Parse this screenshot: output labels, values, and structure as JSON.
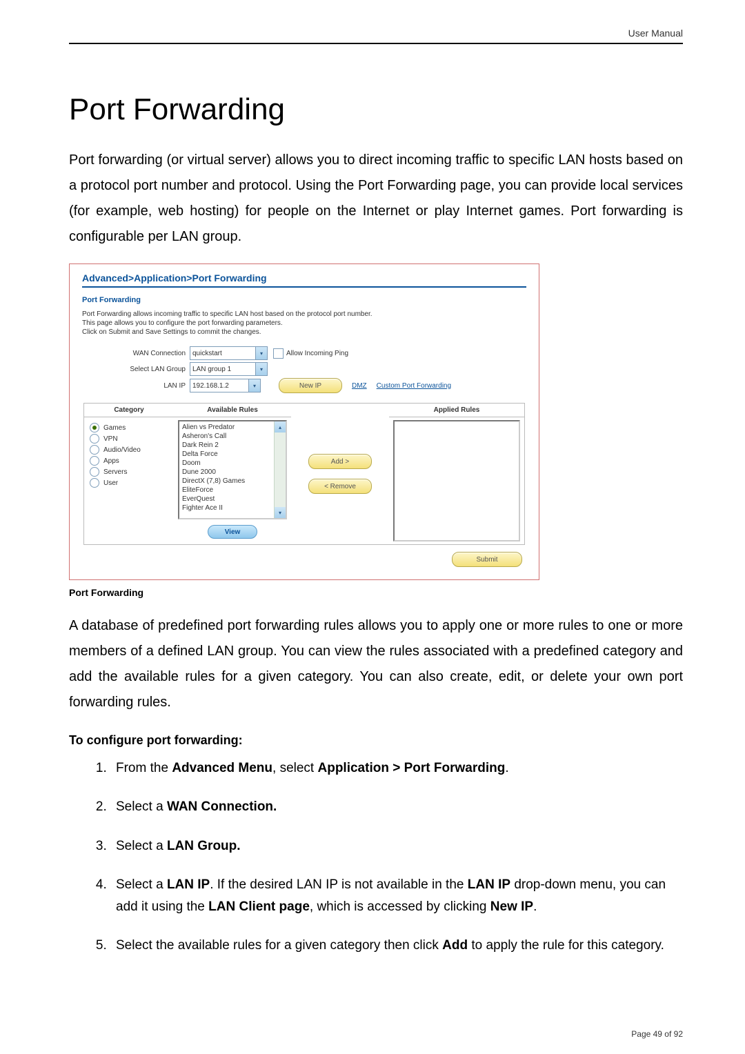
{
  "header": {
    "doc_label": "User Manual"
  },
  "title": "Port Forwarding",
  "intro": "Port forwarding (or virtual server) allows you to direct incoming traffic to specific LAN hosts based on a protocol port number and protocol. Using the Port Forwarding page, you can provide local services (for example, web hosting) for people on the Internet or play Internet games. Port forwarding is configurable per LAN group.",
  "figure": {
    "breadcrumb": "Advanced>Application>Port Forwarding",
    "panel_title": "Port Forwarding",
    "desc1": "Port Forwarding allows incoming traffic to specific LAN host based on the protocol port number.",
    "desc2": "This page allows you to configure the port forwarding parameters.",
    "desc3": "Click on Submit and Save Settings to commit the changes.",
    "labels": {
      "wan": "WAN Connection",
      "lan_group": "Select LAN Group",
      "lan_ip": "LAN IP",
      "allow_ping": "Allow Incoming Ping"
    },
    "values": {
      "wan": "quickstart",
      "lan_group": "LAN group 1",
      "lan_ip": "192.168.1.2"
    },
    "buttons": {
      "new_ip": "New IP",
      "add": "Add >",
      "remove": "< Remove",
      "view": "View",
      "submit": "Submit"
    },
    "links": {
      "dmz": "DMZ",
      "custom": "Custom Port Forwarding"
    },
    "columns": {
      "category": "Category",
      "available": "Available Rules",
      "applied": "Applied Rules"
    },
    "categories": [
      "Games",
      "VPN",
      "Audio/Video",
      "Apps",
      "Servers",
      "User"
    ],
    "selected_category_index": 0,
    "available_rules": [
      "Alien vs Predator",
      "Asheron's Call",
      "Dark Rein 2",
      "Delta Force",
      "Doom",
      "Dune 2000",
      "DirectX (7,8) Games",
      "EliteForce",
      "EverQuest",
      "Fighter Ace II"
    ]
  },
  "caption": "Port Forwarding",
  "para2": "A database of predefined port forwarding rules allows you to apply one or more rules to one or more members of a defined LAN group. You can view the rules associated with a predefined category and add the available rules for a given category. You can also create, edit, or delete your own port forwarding rules.",
  "subhead": "To configure port forwarding:",
  "steps": {
    "s1a": "From the ",
    "s1b": "Advanced Menu",
    "s1c": ", select ",
    "s1d": "Application > Port Forwarding",
    "s1e": ".",
    "s2a": "Select a ",
    "s2b": "WAN Connection.",
    "s3a": "Select a ",
    "s3b": "LAN Group.",
    "s4a": "Select a ",
    "s4b": "LAN IP",
    "s4c": ". If the desired LAN IP is not available in the ",
    "s4d": "LAN IP",
    "s4e": " drop-down menu, you can add it using the ",
    "s4f": "LAN Client page",
    "s4g": ", which is accessed by clicking ",
    "s4h": "New IP",
    "s4i": ".",
    "s5a": "Select the available rules for a given category then click ",
    "s5b": "Add",
    "s5c": " to apply the rule for this category."
  },
  "footer": {
    "page": "Page 49 of 92"
  }
}
